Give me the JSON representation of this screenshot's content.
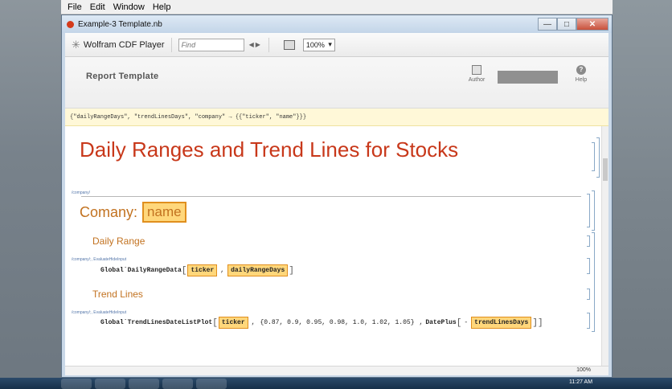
{
  "menu": [
    "File",
    "Edit",
    "Window",
    "Help"
  ],
  "window": {
    "title": "Example-3 Template.nb"
  },
  "toolbar": {
    "app_name": "Wolfram CDF Player",
    "find_placeholder": "Find",
    "zoom": "100%"
  },
  "report": {
    "title": "Report Template",
    "author_label": "Author",
    "help_label": "Help"
  },
  "notebook": {
    "bar_text": "{\"dailyRangeDays\", \"trendLinesDays\", \"company\" → {{\"ticker\", \"name\"}}}",
    "heading": "Daily Ranges and Trend Lines for Stocks",
    "tag_company": "/company/",
    "company_label": "Comany:",
    "company_slot": "name",
    "daily_range": "Daily Range",
    "tag_eval1": "/company/;, EvaluateHideInput",
    "code1_fn": "Global`DailyRangeData",
    "code1_arg1": "ticker",
    "code1_arg2": "dailyRangeDays",
    "trend_lines": "Trend Lines",
    "tag_eval2": "/company/;, EvaluateHideInput",
    "code2_fn": "Global`TrendLinesDateListPlot",
    "code2_arg1": "ticker",
    "code2_list": "{0.87, 0.9, 0.95, 0.98, 1.0, 1.02, 1.05}",
    "code2_fn2": "DatePlus",
    "code2_arg2": "trendLinesDays"
  },
  "status": {
    "zoom": "100%"
  },
  "taskbar": {
    "clock": "11:27 AM"
  }
}
